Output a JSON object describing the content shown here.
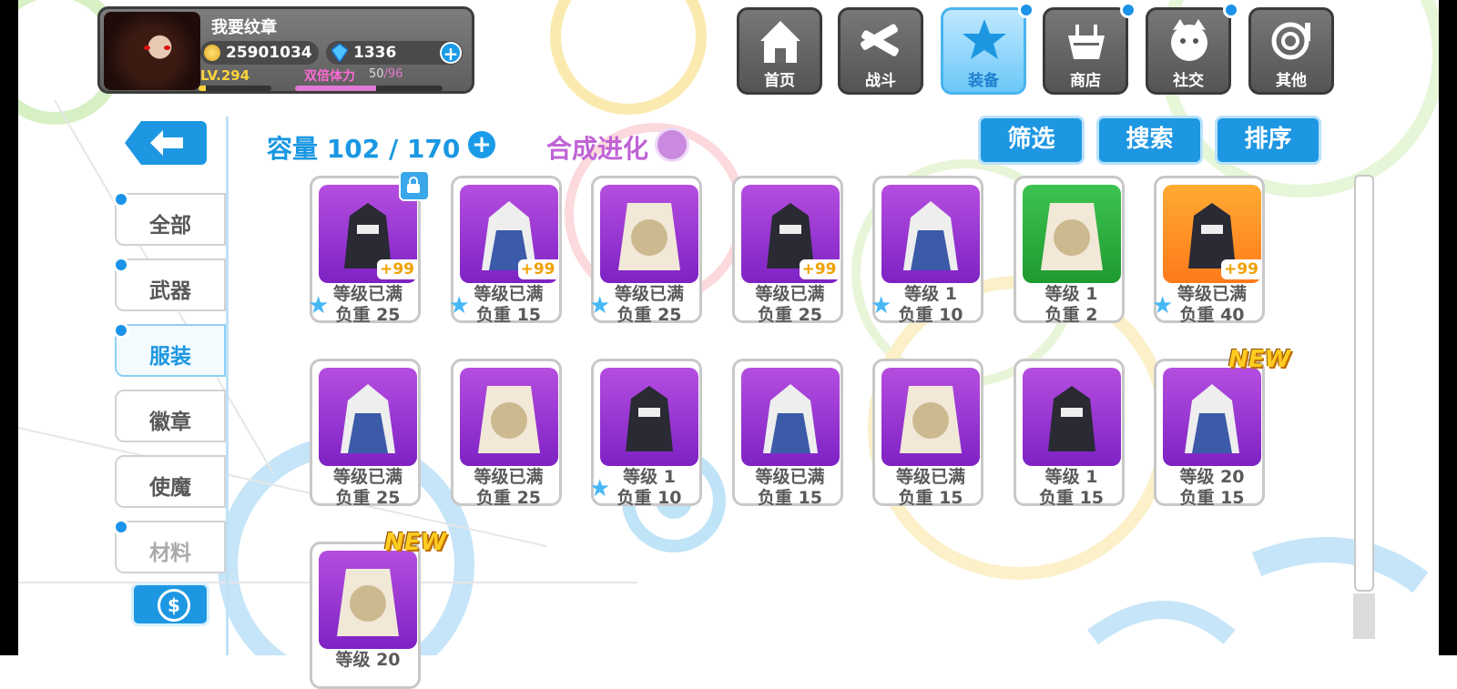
{
  "player": {
    "name": "我要纹章",
    "gold": "25901034",
    "gems": "1336",
    "level": "LV.294",
    "double_stamina_label": "双倍体力",
    "stamina": "50",
    "stamina_suffix": "/96",
    "xp_progress": 0.1,
    "stamina_progress": 0.55
  },
  "nav": [
    {
      "label": "首页",
      "icon": "house-icon",
      "active": false,
      "dot": false
    },
    {
      "label": "战斗",
      "icon": "crossed-guns-icon",
      "active": false,
      "dot": false
    },
    {
      "label": "装备",
      "icon": "star-gun-icon",
      "active": true,
      "dot": true
    },
    {
      "label": "商店",
      "icon": "shopping-basket-icon",
      "active": false,
      "dot": true
    },
    {
      "label": "社交",
      "icon": "mascot-face-icon",
      "active": false,
      "dot": true
    },
    {
      "label": "其他",
      "icon": "rose-icon",
      "active": false,
      "dot": false
    }
  ],
  "menu": [
    {
      "label": "全部",
      "dot": true,
      "active": false
    },
    {
      "label": "武器",
      "dot": true,
      "active": false
    },
    {
      "label": "服装",
      "dot": true,
      "active": true
    },
    {
      "label": "徽章",
      "dot": false,
      "active": false
    },
    {
      "label": "使魔",
      "dot": false,
      "active": false
    },
    {
      "label": "材料",
      "dot": true,
      "active": false
    }
  ],
  "capacity": {
    "label": "容量 102 / 170"
  },
  "synthesis": {
    "label": "合成进化"
  },
  "filters": {
    "filter": "筛选",
    "search": "搜索",
    "sort": "排序"
  },
  "items": [
    {
      "line1": "等级已满",
      "line2": "负重 25",
      "bg": "purple",
      "plus": "+99",
      "star": true,
      "new": false
    },
    {
      "line1": "等级已满",
      "line2": "负重 15",
      "bg": "purple",
      "plus": "+99",
      "star": true,
      "new": false
    },
    {
      "line1": "等级已满",
      "line2": "负重 25",
      "bg": "purple",
      "plus": "",
      "star": true,
      "new": false
    },
    {
      "line1": "等级已满",
      "line2": "负重 25",
      "bg": "purple",
      "plus": "+99",
      "star": false,
      "new": false
    },
    {
      "line1": "等级 1",
      "line2": "负重 10",
      "bg": "purple",
      "plus": "",
      "star": true,
      "new": false
    },
    {
      "line1": "等级 1",
      "line2": "负重 2",
      "bg": "green",
      "plus": "",
      "star": false,
      "new": false
    },
    {
      "line1": "等级已满",
      "line2": "负重 40",
      "bg": "orange",
      "plus": "+99",
      "star": true,
      "new": false
    },
    {
      "line1": "等级已满",
      "line2": "负重 25",
      "bg": "purple",
      "plus": "",
      "star": false,
      "new": false
    },
    {
      "line1": "等级已满",
      "line2": "负重 25",
      "bg": "purple",
      "plus": "",
      "star": false,
      "new": false
    },
    {
      "line1": "等级 1",
      "line2": "负重 10",
      "bg": "purple",
      "plus": "",
      "star": true,
      "new": false
    },
    {
      "line1": "等级已满",
      "line2": "负重 15",
      "bg": "purple",
      "plus": "",
      "star": false,
      "new": false
    },
    {
      "line1": "等级已满",
      "line2": "负重 15",
      "bg": "purple",
      "plus": "",
      "star": false,
      "new": false
    },
    {
      "line1": "等级 1",
      "line2": "负重 15",
      "bg": "purple",
      "plus": "",
      "star": false,
      "new": false
    },
    {
      "line1": "等级 20",
      "line2": "负重 15",
      "bg": "purple",
      "plus": "",
      "star": false,
      "new": true
    },
    {
      "line1": "等级 20",
      "line2": "",
      "bg": "purple",
      "plus": "",
      "star": false,
      "new": true
    }
  ],
  "new_label": "NEW",
  "colors": {
    "accent": "#1e97e2",
    "synthesis": "#c063d6",
    "gold_text": "#ffd33c"
  }
}
